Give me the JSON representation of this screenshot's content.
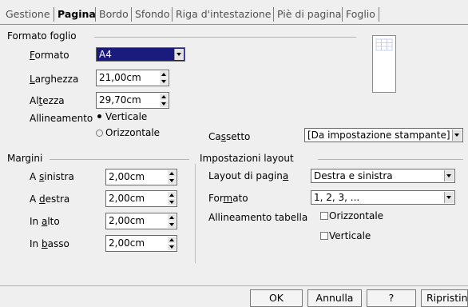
{
  "tabs": [
    "Gestione",
    "Pagina",
    "Bordo",
    "Sfondo",
    "Riga d'intestazione",
    "Piè di pagina",
    "Foglio"
  ],
  "active_tab": "Pagina",
  "page_format": {
    "group_title": "Formato foglio",
    "format_label": "Formato",
    "format_value": "A4",
    "width_label": "Larghezza",
    "width_value": "21,00cm",
    "height_label": "Altezza",
    "height_value": "29,70cm",
    "orientation_label": "Allineamento",
    "portrait_label": "Verticale",
    "landscape_label": "Orizzontale",
    "portrait_selected": true,
    "tray_label": "Cassetto",
    "tray_value": "[Da impostazione stampante]"
  },
  "margins": {
    "group_title": "Margini",
    "left_label": "A sinistra",
    "left_value": "2,00cm",
    "right_label": "A destra",
    "right_value": "2,00cm",
    "top_label": "In alto",
    "top_value": "2,00cm",
    "bottom_label": "In basso",
    "bottom_value": "2,00cm"
  },
  "layout": {
    "group_title": "Impostazioni layout",
    "page_layout_label": "Layout di pagina",
    "page_layout_value": "Destra e sinistra",
    "format_label": "Formato",
    "format_value": "1, 2, 3, ...",
    "table_align_label": "Allineamento tabella",
    "horizontal_label": "Orizzontale",
    "vertical_label": "Verticale"
  },
  "buttons": {
    "ok": "OK",
    "cancel": "Annulla",
    "help": "?",
    "reset": "Ripristina"
  }
}
